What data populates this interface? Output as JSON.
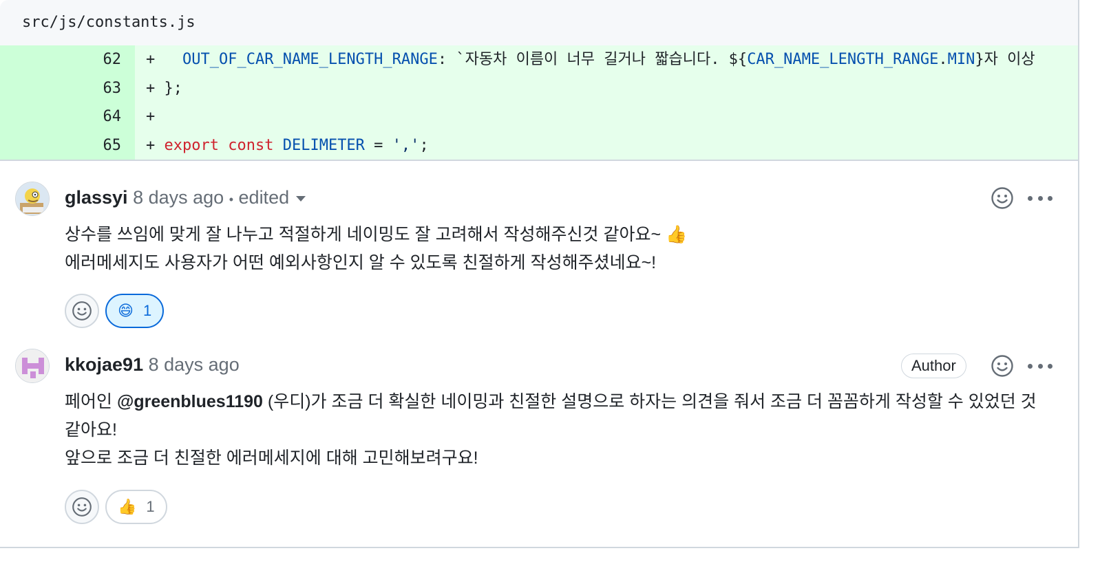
{
  "file": {
    "path": "src/js/constants.js"
  },
  "diff_lines": [
    {
      "num": "62",
      "prefix": "+",
      "indent": "   ",
      "key": "OUT_OF_CAR_NAME_LENGTH_RANGE",
      "rest_a": ": `자동차 이름이 너무 길거나 짧습니다. ${",
      "ref_obj": "CAR_NAME_LENGTH_RANGE",
      "dot": ".",
      "ref_prop": "MIN",
      "rest_b": "}자 이상"
    },
    {
      "num": "63",
      "prefix": "+",
      "text": " };"
    },
    {
      "num": "64",
      "prefix": "+",
      "text": ""
    },
    {
      "num": "65",
      "prefix": "+",
      "kw1": "export",
      "kw2": "const",
      "name": "DELIMETER",
      "eq": " = ",
      "str": "','",
      "end": ";"
    }
  ],
  "comments": [
    {
      "author": "glassyi",
      "time": "8 days ago",
      "separator": "•",
      "edited": "edited",
      "body": [
        "상수를 쓰임에 맞게 잘 나누고 적절하게 네이밍도 잘 고려해서 작성해주신것 같아요~ 👍",
        "에러메세지도 사용자가 어떤 예외사항인지 알 수 있도록 친절하게 작성해주셨네요~!"
      ],
      "reaction": {
        "emoji": "😄",
        "count": "1"
      },
      "avatar_icon": "homer-avatar-icon"
    },
    {
      "author": "kkojae91",
      "time": "8 days ago",
      "badge": "Author",
      "body_pre": "페어인 ",
      "mention": "@greenblues1190",
      "body_post": " (우디)가 조금 더 확실한 네이밍과 친절한 설명으로 하자는 의견을 줘서 조금 더 꼼꼼하게 작성할 수 있었던 것 같아요!",
      "body_line2": "앞으로 조금 더 친절한 에러메세지에 대해 고민해보려구요!",
      "reaction": {
        "emoji": "👍",
        "count": "1"
      },
      "avatar_icon": "identicon-avatar-icon"
    }
  ],
  "colors": {
    "added_line_bg": "#e6ffec",
    "added_num_bg": "#ccffd8",
    "accent": "#0969da",
    "muted": "#656d76"
  }
}
